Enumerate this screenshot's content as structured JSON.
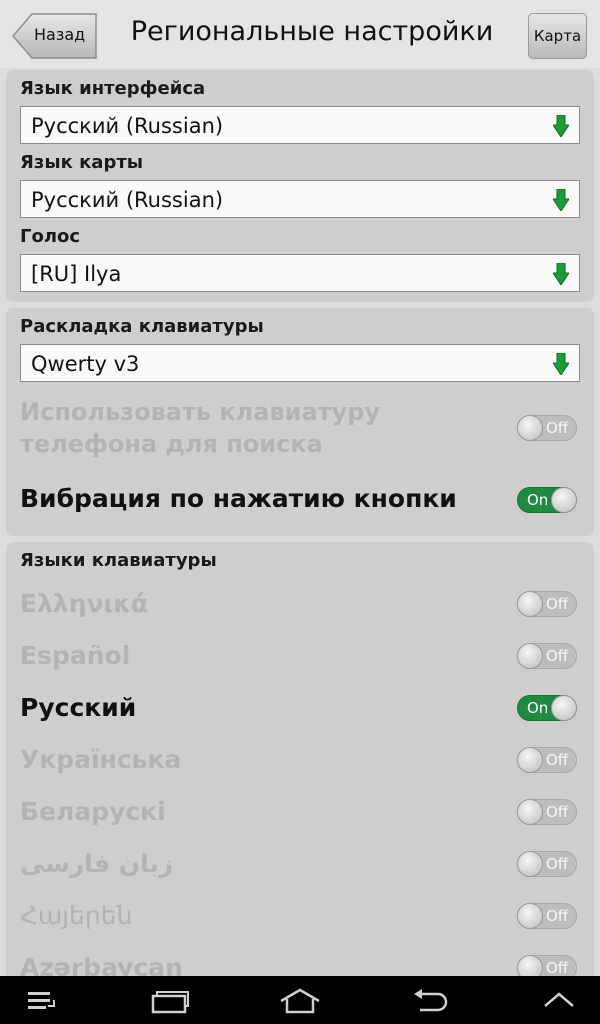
{
  "header": {
    "back_label": "Назад",
    "title": "Региональные настройки",
    "map_label": "Карта"
  },
  "language_panel": {
    "interface_language_label": "Язык интерфейса",
    "interface_language_value": "Русский (Russian)",
    "map_language_label": "Язык карты",
    "map_language_value": "Русский (Russian)",
    "voice_label": "Голос",
    "voice_value": "[RU] Ilya"
  },
  "keyboard_panel": {
    "layout_label": "Раскладка клавиатуры",
    "layout_value": "Qwerty v3",
    "phone_keyboard_label": "Использовать клавиатуру телефона для поиска",
    "phone_keyboard_state": "Off",
    "vibration_label": "Вибрация по нажатию кнопки",
    "vibration_state": "On"
  },
  "keyboard_languages": {
    "title": "Языки клавиатуры",
    "items": [
      {
        "label": "Ελληνικά",
        "state": "Off"
      },
      {
        "label": "Español",
        "state": "Off"
      },
      {
        "label": "Русский",
        "state": "On"
      },
      {
        "label": "Українська",
        "state": "Off"
      },
      {
        "label": "Беларускі",
        "state": "Off"
      },
      {
        "label": "زبان فارسی",
        "state": "Off"
      },
      {
        "label": "Հայերեն",
        "state": "Off"
      },
      {
        "label": "Azərbaycan",
        "state": "Off"
      }
    ]
  },
  "colors": {
    "panel_bg": "#cecece",
    "page_bg": "#dcdcdc",
    "toggle_on": "#1f8a3f",
    "dropdown_arrow": "#1f9a3a"
  },
  "icons": {
    "dropdown": "green-down-arrow-icon",
    "nav": [
      "menu-icon",
      "recent-apps-icon",
      "home-icon",
      "back-icon",
      "chevron-up-icon"
    ]
  }
}
